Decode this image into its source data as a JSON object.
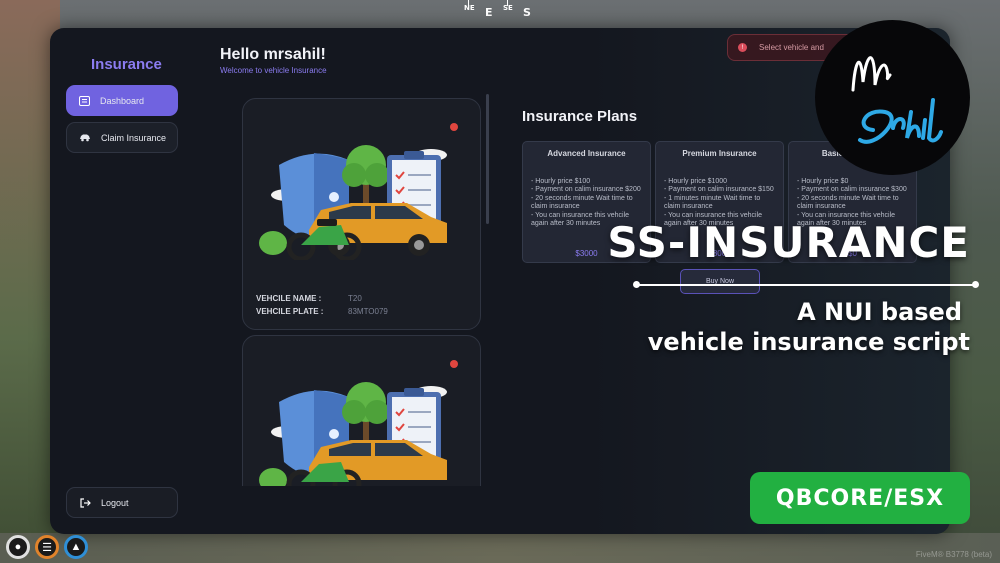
{
  "compass": {
    "ne": "NE",
    "e": "E",
    "se": "SE",
    "s": "S"
  },
  "sidebar": {
    "brand": "Insurance",
    "items": [
      {
        "label": "Dashboard",
        "icon": "dashboard-icon",
        "active": true
      },
      {
        "label": "Claim Insurance",
        "icon": "car-icon",
        "active": false
      }
    ],
    "logout": "Logout"
  },
  "header": {
    "greeting": "Hello mrsahil!",
    "subtitle": "Welcome to vehicle Insurance"
  },
  "toast": {
    "text": "Select vehicle and"
  },
  "vehicles": [
    {
      "name_label": "VEHCILE NAME :",
      "name": "T20",
      "plate_label": "VEHCILE PLATE :",
      "plate": "83MTO079"
    },
    {
      "name_label": "",
      "name": "",
      "plate_label": "",
      "plate": ""
    }
  ],
  "plans": {
    "title": "Insurance Plans",
    "items": [
      {
        "name": "Advanced Insurance",
        "details": "- Hourly price $100\n- Payment on calim insurance $200\n- 20 seconds minute Wait time to claim insurance\n- You can insurance this vehcile again after 30 minutes",
        "price": "$3000"
      },
      {
        "name": "Premium Insurance",
        "details": "- Hourly price $1000\n- Payment on calim insurance $150\n- 1 minutes minute Wait time to claim insurance\n- You can insurance this vehcile again after 30 minutes",
        "price": "$8000"
      },
      {
        "name": "Basic Insurance",
        "details": "- Hourly price $0\n- Payment on calim insurance $300\n- 20 seconds minute Wait time to claim insurance\n- You can insurance this vehcile again after 30 minutes",
        "price": "$0"
      }
    ],
    "buy_label": "Buy Now"
  },
  "overlay": {
    "headline": "SS-INSURANCE",
    "tagline_1": "A NUI based",
    "tagline_2": "vehicle insurance script",
    "framework": "QBCORE/ESX",
    "logo_text": "Mr Sahil",
    "logo_color": "#2ea9e6"
  },
  "hud": [
    "microphone-icon",
    "burger-icon",
    "water-drop-icon"
  ],
  "watermark": "FiveM® B3778 (beta)",
  "colors": {
    "accent": "#7063e0",
    "panel": "#14171f",
    "badge": "#22b041"
  }
}
